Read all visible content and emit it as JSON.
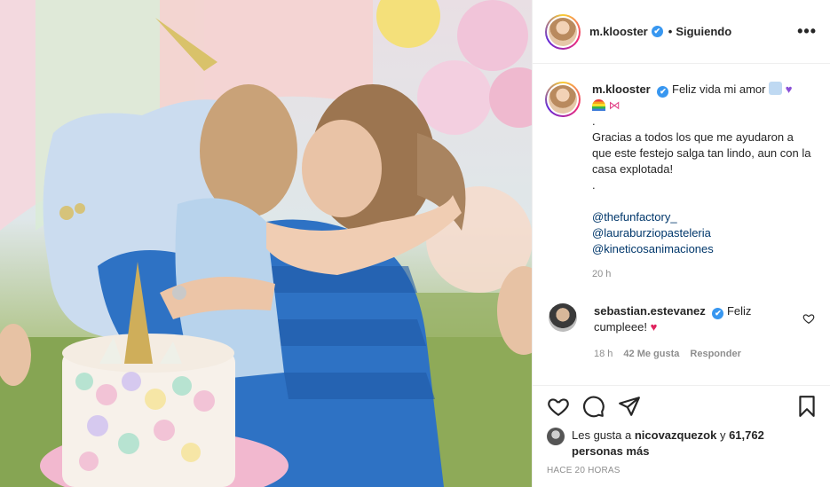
{
  "post": {
    "username": "m.klooster",
    "verified_mark": "✔",
    "separator": "•",
    "follow_status": "Siguiendo",
    "more_options": "•••"
  },
  "caption": {
    "username": "m.klooster",
    "line1": "Feliz vida mi amor",
    "dot1": ".",
    "body": "Gracias a todos los que me ayudaron a que este festejo salga tan lindo, aun con la casa explotada!",
    "dot2": ".",
    "mentions": [
      "@thefunfactory_",
      "@lauraburziopasteleria",
      "@kineticosanimaciones"
    ],
    "time": "20 h"
  },
  "comment": {
    "username": "sebastian.estevanez",
    "text_a": "Feliz",
    "text_b": "cumpleee!",
    "time": "18 h",
    "likes": "42 Me gusta",
    "reply": "Responder"
  },
  "likes": {
    "prefix": "Les gusta a",
    "user": "nicovazquezok",
    "joiner": "y",
    "count": "61,762 personas más"
  },
  "timestamp": "HACE 20 HORAS",
  "icons": {
    "like": "heart-icon",
    "comment": "comment-icon",
    "share": "paper-plane-icon",
    "save": "bookmark-icon",
    "more": "more-options-icon"
  },
  "colors": {
    "verified": "#3897f0",
    "mention": "#00376b",
    "muted": "#8e8e8e",
    "border": "#efefef"
  }
}
